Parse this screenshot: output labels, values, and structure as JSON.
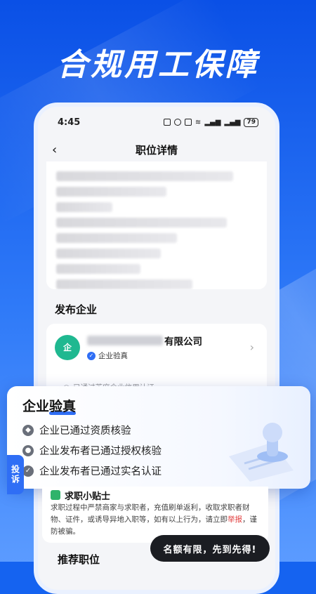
{
  "headline": "合规用工保障",
  "status_bar": {
    "time": "4:45",
    "battery": "79"
  },
  "nav": {
    "title": "职位详情",
    "back_icon": "chevron-left-icon"
  },
  "section_publisher": "发布企业",
  "company": {
    "name_visible_suffix": "有限公司",
    "verified_label": "企业验真",
    "credit_note": "已通过芝麻企业信用认证"
  },
  "overlay": {
    "title": "企业验真",
    "items": [
      {
        "icon": "diamond-icon",
        "text": "企业已通过资质核验"
      },
      {
        "icon": "person-icon",
        "text": "企业发布者已通过授权核验"
      },
      {
        "icon": "shield-icon",
        "text": "企业发布者已通过实名认证"
      }
    ]
  },
  "complain_tab": "投诉",
  "tips": {
    "title": "求职小贴士",
    "text_before": "求职过程中严禁商家与求职者，充值刷单返利，收取求职者财物、证件，或诱导异地入职等，如有以上行为，请立即",
    "highlight": "举报",
    "text_after": "，谨防被骗。"
  },
  "recommend_title": "推荐职位",
  "cta_label": "名额有限，先到先得!",
  "colors": {
    "accent": "#2f6ef5",
    "bg": "#1563f0",
    "company_logo": "#1fb890",
    "cta": "#1b1d22",
    "report": "#e13c3c"
  }
}
